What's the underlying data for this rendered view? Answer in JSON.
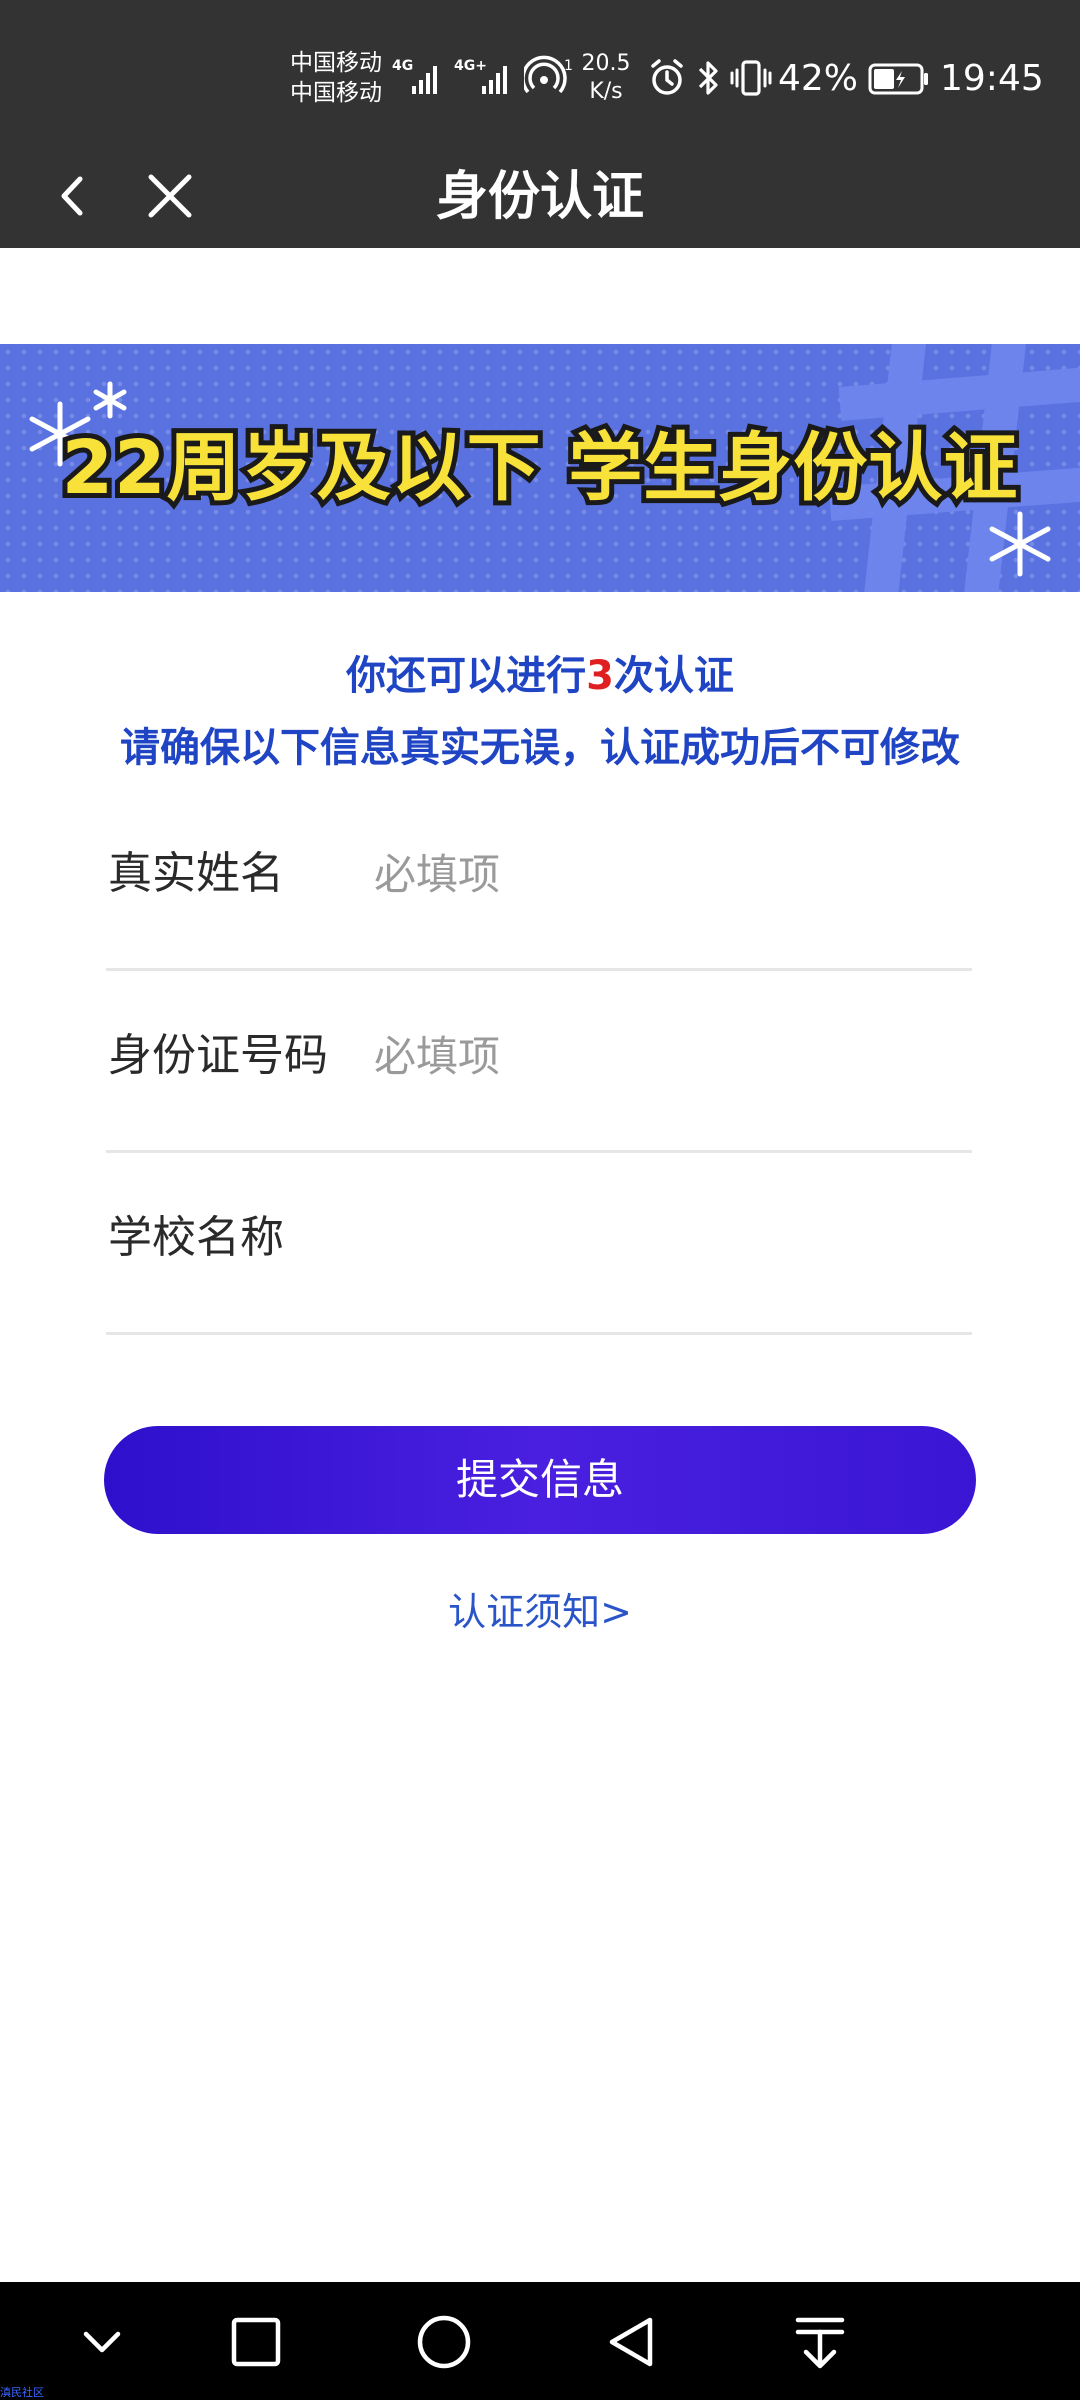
{
  "status_bar": {
    "carrier_1": "中国移动",
    "carrier_2": "中国移动",
    "signal_1_label": "4G",
    "signal_2_label": "4G+",
    "net_speed_value": "20.5",
    "net_speed_unit": "K/s",
    "hotspot_count": "1",
    "battery_percent": "42%",
    "time": "19:45",
    "icons": [
      "signal-icon",
      "hotspot-icon",
      "alarm-icon",
      "bluetooth-icon",
      "vibrate-icon",
      "battery-icon"
    ]
  },
  "nav": {
    "title": "身份认证",
    "back_icon": "chevron-left-icon",
    "close_icon": "close-icon"
  },
  "banner": {
    "text": "22周岁及以下 学生身份认证"
  },
  "notice": {
    "line1_prefix": "你还可以进行",
    "line1_count": "3",
    "line1_suffix": "次认证",
    "line2": "请确保以下信息真实无误，认证成功后不可修改"
  },
  "form": {
    "fields": [
      {
        "label": "真实姓名",
        "placeholder": "必填项",
        "value": ""
      },
      {
        "label": "身份证号码",
        "placeholder": "必填项",
        "value": ""
      },
      {
        "label": "学校名称",
        "placeholder": "",
        "value": ""
      }
    ],
    "submit_label": "提交信息",
    "notice_link": "认证须知>"
  },
  "system_nav": {
    "icons": [
      "collapse-icon",
      "recent-apps-icon",
      "home-icon",
      "back-icon",
      "notification-pull-icon"
    ]
  },
  "watermark": "滇民社区",
  "colors": {
    "header_bg": "#333333",
    "accent_purple": "#3a16d4",
    "notice_blue": "#1f44c4",
    "count_red": "#e02020",
    "banner_bg": "#5a72e0",
    "banner_text": "#f8e23a"
  }
}
